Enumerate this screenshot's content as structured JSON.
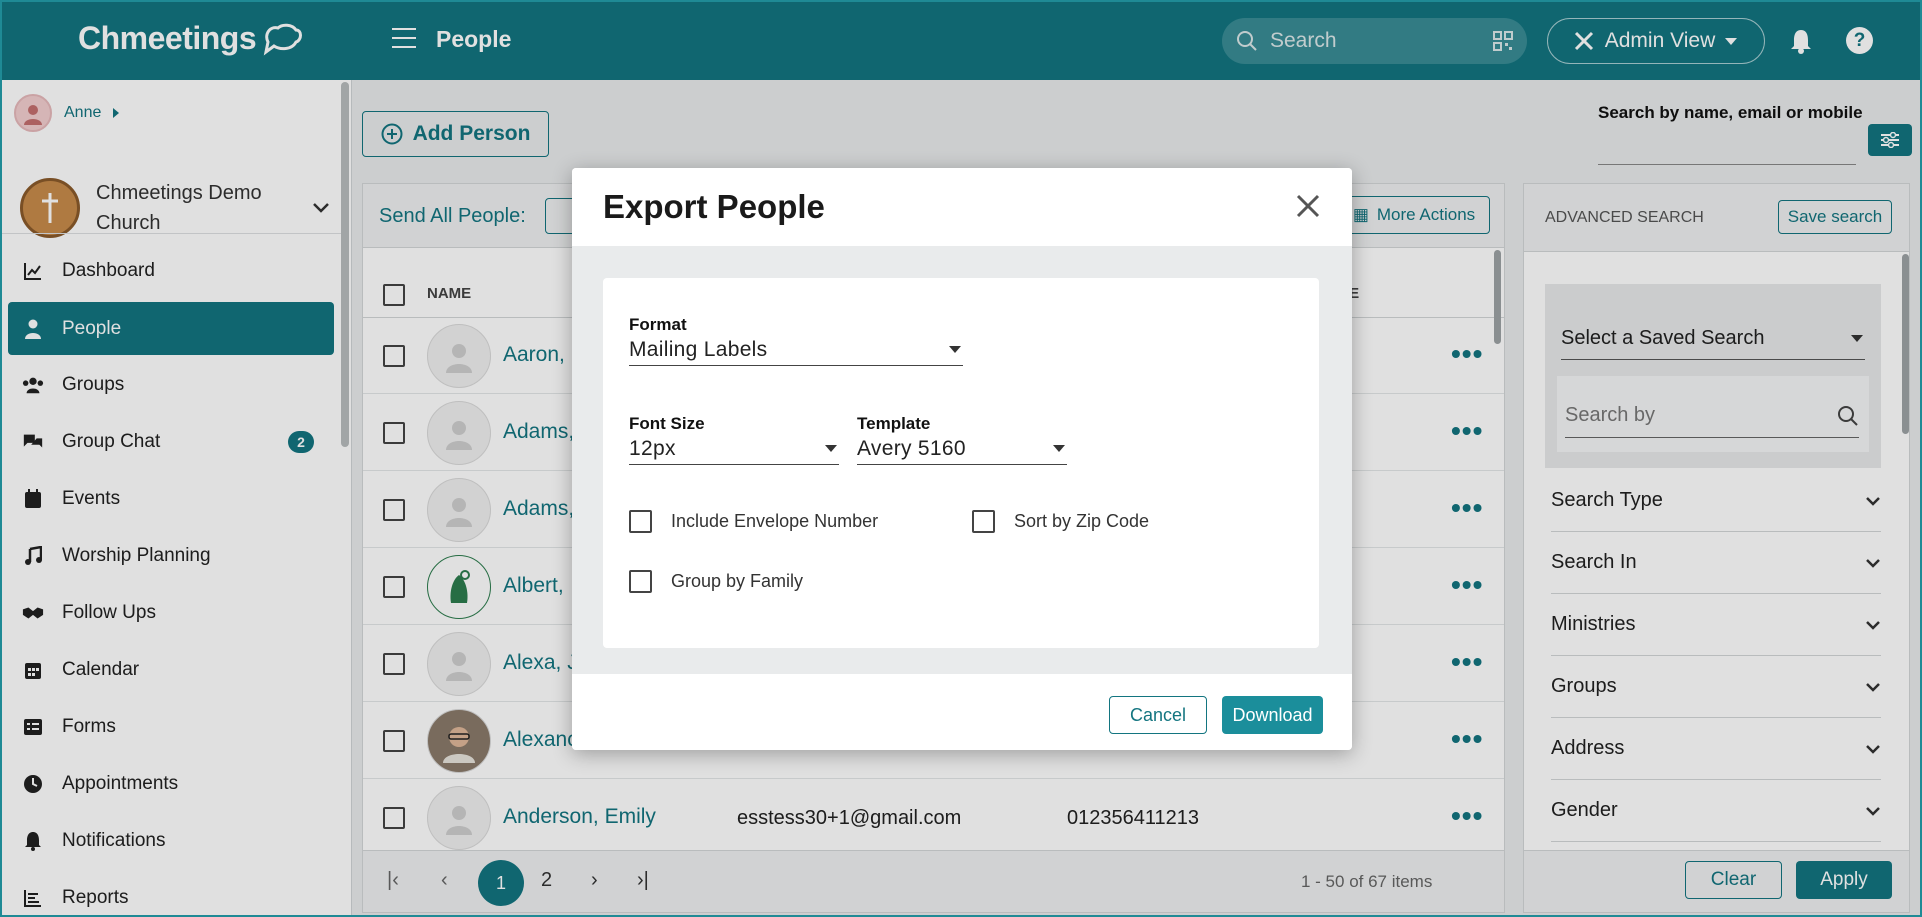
{
  "topbar": {
    "logo": "Chmeetings",
    "page_title": "People",
    "search_placeholder": "Search",
    "admin_view": "Admin View"
  },
  "sidebar": {
    "user": "Anne",
    "church": "Chmeetings Demo Church",
    "items": [
      {
        "label": "Dashboard",
        "icon": "chart-line-icon"
      },
      {
        "label": "People",
        "icon": "person-icon",
        "active": true
      },
      {
        "label": "Groups",
        "icon": "users-icon"
      },
      {
        "label": "Group Chat",
        "icon": "chat-icon",
        "badge": "2"
      },
      {
        "label": "Events",
        "icon": "calendar-icon"
      },
      {
        "label": "Worship Planning",
        "icon": "music-note-icon"
      },
      {
        "label": "Follow Ups",
        "icon": "handshake-icon"
      },
      {
        "label": "Calendar",
        "icon": "calendar-grid-icon"
      },
      {
        "label": "Forms",
        "icon": "form-icon"
      },
      {
        "label": "Appointments",
        "icon": "clock-icon"
      },
      {
        "label": "Notifications",
        "icon": "bell-icon"
      },
      {
        "label": "Reports",
        "icon": "report-icon"
      }
    ]
  },
  "main": {
    "add_person": "Add Person",
    "search_label": "Search by name, email or mobile",
    "send_all": "Send All People:",
    "more_actions": "More Actions",
    "col_name": "NAME",
    "col_phone_partial": "IE",
    "rows": [
      {
        "name": "Aaron, I",
        "email": "",
        "phone": ""
      },
      {
        "name": "Adams,",
        "email": "",
        "phone": ""
      },
      {
        "name": "Adams,",
        "email": "",
        "phone": ""
      },
      {
        "name": "Albert,",
        "email": "",
        "phone": ""
      },
      {
        "name": "Alexa, J",
        "email": "",
        "phone": ""
      },
      {
        "name": "Alexanc",
        "email": "",
        "phone": ""
      },
      {
        "name": "Anderson, Emily",
        "email": "esstess30+1@gmail.com",
        "phone": "012356411213"
      }
    ],
    "pager": {
      "current": "1",
      "next": "2",
      "items_info": "1 - 50 of 67 items"
    }
  },
  "advanced": {
    "title": "ADVANCED SEARCH",
    "save_search": "Save search",
    "saved_select": "Select a Saved Search",
    "search_by": "Search by",
    "sections": [
      "Search Type",
      "Search In",
      "Ministries",
      "Groups",
      "Address",
      "Gender"
    ],
    "clear": "Clear",
    "apply": "Apply"
  },
  "modal": {
    "title": "Export People",
    "format_label": "Format",
    "format_value": "Mailing Labels",
    "font_size_label": "Font Size",
    "font_size_value": "12px",
    "template_label": "Template",
    "template_value": "Avery 5160",
    "include_envelope": "Include Envelope Number",
    "sort_zip": "Sort by Zip Code",
    "group_family": "Group by Family",
    "cancel": "Cancel",
    "download": "Download"
  },
  "colors": {
    "brand": "#137580",
    "download": "#1b8e9b"
  }
}
